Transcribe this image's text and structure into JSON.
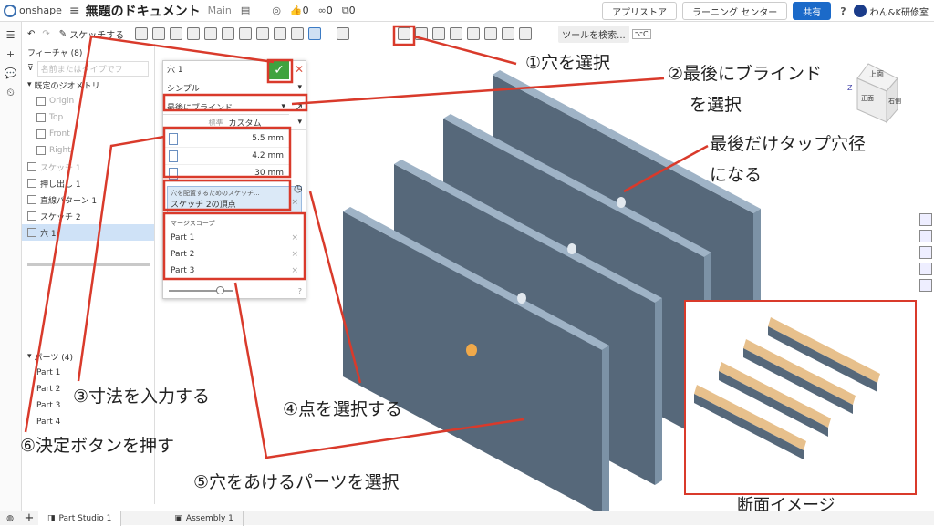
{
  "app": {
    "brand": "onshape",
    "title": "無題のドキュメント",
    "branch": "Main"
  },
  "topbar": {
    "likes": "0",
    "links": "0",
    "copies": "0",
    "appstore": "アプリストア",
    "learning": "ラーニング センター",
    "share": "共有",
    "help": "?",
    "user": "わん&K研修室"
  },
  "toolbar": {
    "sketch": "スケッチする",
    "search": "ツールを検索...",
    "shortcut": "⌥C"
  },
  "feature_panel": {
    "title": "フィーチャ (8)",
    "search_placeholder": "名前またはタイプでフ",
    "default_geometry": "既定のジオメトリ",
    "items": [
      {
        "label": "Origin",
        "dim": true
      },
      {
        "label": "Top",
        "dim": true
      },
      {
        "label": "Front",
        "dim": true
      },
      {
        "label": "Right",
        "dim": true
      },
      {
        "label": "スケッチ 1",
        "dim": true
      },
      {
        "label": "押し出し 1",
        "dim": false
      },
      {
        "label": "直線パターン 1",
        "dim": false
      },
      {
        "label": "スケッチ 2",
        "dim": false
      },
      {
        "label": "穴 1",
        "dim": false,
        "selected": true
      }
    ],
    "parts_header": "パーツ (4)",
    "parts": [
      "Part 1",
      "Part 2",
      "Part 3",
      "Part 4"
    ]
  },
  "hole_dialog": {
    "title": "穴 1",
    "type": "シンプル",
    "end_type": "最後にブラインド",
    "standard_label": "標準",
    "standard_value": "カスタム",
    "dims": [
      "5.5 mm",
      "4.2 mm",
      "30 mm"
    ],
    "sketch_label": "穴を配置するためのスケッチ...",
    "sketch_value": "スケッチ 2の頂点",
    "merge_label": "マージスコープ",
    "merge_parts": [
      "Part 1",
      "Part 2",
      "Part 3"
    ],
    "help": "?"
  },
  "viewcube": {
    "top": "上面",
    "front": "正面",
    "right": "右側",
    "z": "Z"
  },
  "bottom_tabs": [
    "Part Studio 1",
    "Assembly 1"
  ],
  "callouts": {
    "c1": "①穴を選択",
    "c2_line1": "②最後にブラインド",
    "c2_line2": "を選択",
    "c_last_line1": "最後だけタップ穴径",
    "c_last_line2": "になる",
    "c3": "③寸法を入力する",
    "c4": "④点を選択する",
    "c5": "⑤穴をあけるパーツを選択",
    "c6": "⑥決定ボタンを押す",
    "section": "断面イメージ"
  },
  "colors": {
    "annotation_red": "#d93a2b",
    "accent_blue": "#1b6ac9",
    "plate": "#56687a",
    "wood": "#e7c08c",
    "confirm_green": "#3fa33f"
  }
}
